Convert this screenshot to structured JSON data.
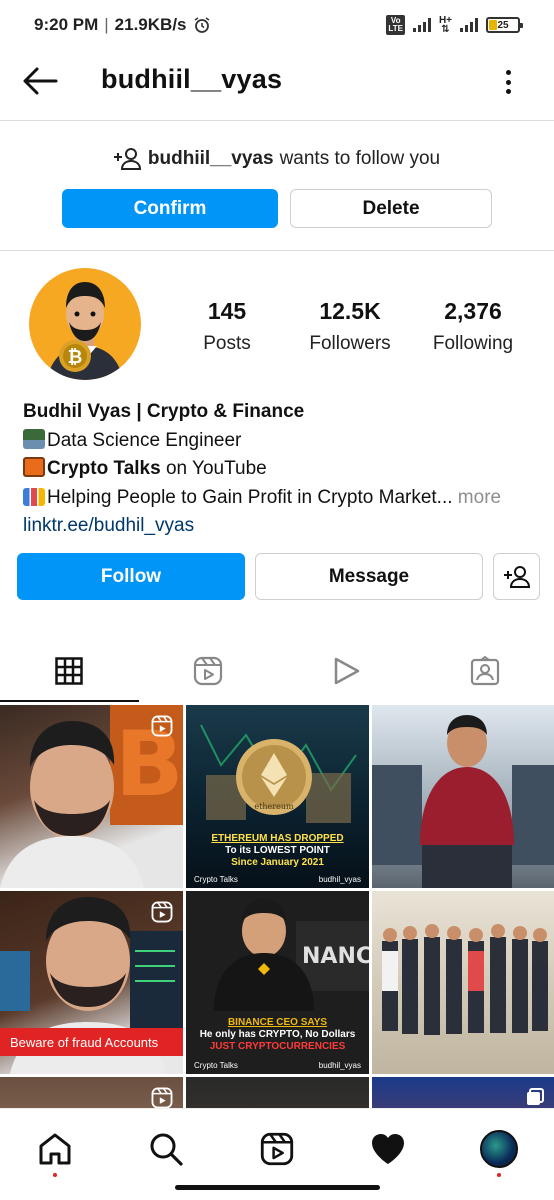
{
  "status": {
    "time": "9:20 PM",
    "speed": "21.9KB/s",
    "battery": "25",
    "battery_level": 0.25,
    "net_top": "Vo",
    "net_bottom": "LTE",
    "hplus": "H+"
  },
  "header": {
    "username": "budhiil__vyas"
  },
  "follow_request": {
    "username": "budhiil__vyas",
    "message": "wants to follow you",
    "confirm_label": "Confirm",
    "delete_label": "Delete"
  },
  "stats": [
    {
      "value": "145",
      "label": "Posts"
    },
    {
      "value": "12.5K",
      "label": "Followers"
    },
    {
      "value": "2,376",
      "label": "Following"
    }
  ],
  "bio": {
    "name": "Budhil Vyas | Crypto & Finance",
    "line1": "Data Science Engineer",
    "line2_bold": "Crypto Talks",
    "line2_rest": " on YouTube",
    "line3": "Helping People to Gain Profit in Crypto Market...",
    "more": " more",
    "link": "linktr.ee/budhil_vyas"
  },
  "actions": {
    "follow_label": "Follow",
    "message_label": "Message"
  },
  "tabs": [
    "grid-icon",
    "reels-icon",
    "video-icon",
    "tagged-icon"
  ],
  "grid": {
    "post2": {
      "line1": "ETHEREUM HAS DROPPED",
      "line2": "To its LOWEST POINT",
      "line3": "Since January 2021",
      "left": "Crypto Talks",
      "right": "budhil_vyas",
      "coin": "ethereum"
    },
    "post4": {
      "banner": "Beware of fraud Accounts"
    },
    "post5": {
      "line1": "BINANCE CEO SAYS",
      "line2": "He only has CRYPTO, No Dollars",
      "line3": "JUST CRYPTOCURRENCIES",
      "left": "Crypto Talks",
      "right": "budhil_vyas",
      "wall": "NANCE"
    }
  },
  "colors": {
    "accent": "#0095f6",
    "avatar_bg": "#f7a823",
    "warning": "#e02424"
  }
}
